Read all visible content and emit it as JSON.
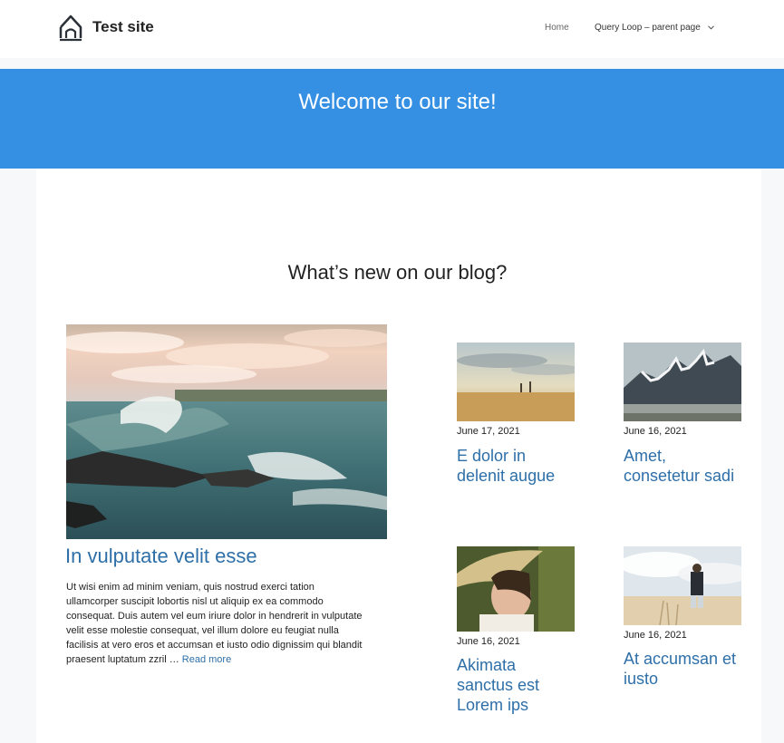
{
  "header": {
    "site_title": "Test site",
    "nav": [
      {
        "label": "Home"
      },
      {
        "label": "Query Loop – parent page"
      }
    ]
  },
  "hero": {
    "title": "Welcome to our site!",
    "background": "#3590e3"
  },
  "blog": {
    "heading": "What’s new on our blog?",
    "link_color": "#2e6fa8",
    "featured": {
      "image": "ocean-waves-sunset",
      "title": "In vulputate velit esse",
      "excerpt": "Ut wisi enim ad minim veniam, quis nostrud exerci tation ullamcorper suscipit lobortis nisl ut aliquip ex ea commodo consequat. Duis autem vel eum iriure dolor in hendrerit in vulputate velit esse molestie consequat, vel illum dolore eu feugiat nulla facilisis at vero eros et accumsan et iusto odio dignissim qui blandit praesent luptatum zzril …",
      "read_more": "Read more"
    },
    "posts": [
      {
        "image": "desert-walkers",
        "date": "June 17, 2021",
        "title_lines": [
          "E dolor in",
          "delenit augue"
        ]
      },
      {
        "image": "mountain-peaks",
        "date": "June 16, 2021",
        "title_lines": [
          "Amet,",
          "consetetur sadi"
        ]
      },
      {
        "image": "woman-straw-hat",
        "date": "June 16, 2021",
        "title_lines": [
          "Akimata",
          "sanctus est",
          "Lorem ips"
        ]
      },
      {
        "image": "couple-in-field",
        "date": "June 16, 2021",
        "title_lines": [
          "At accumsan et",
          "iusto"
        ]
      }
    ]
  }
}
